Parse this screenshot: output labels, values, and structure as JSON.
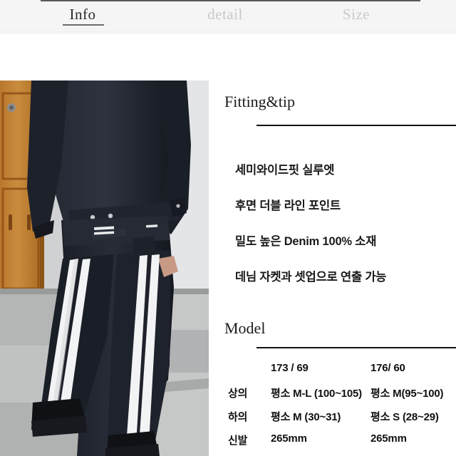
{
  "tabs": [
    {
      "label": "Info",
      "active": true
    },
    {
      "label": "detail",
      "active": false
    },
    {
      "label": "Size",
      "active": false
    }
  ],
  "product_photo": {
    "alt": "Model wearing black denim jacket and black wide-leg denim pants with white double side stripes, standing on concrete steps in front of a wooden door"
  },
  "fitting": {
    "title": "Fitting&tip",
    "features": [
      "세미와이드핏 실루엣",
      "후면 더블 라인 포인트",
      "밀도 높은 Denim 100% 소재",
      "데님 자켓과 셋업으로 연출 가능"
    ]
  },
  "model": {
    "title": "Model",
    "headers": [
      "",
      "173 / 69",
      "176/ 60"
    ],
    "rows": [
      {
        "label": "상의",
        "col1": "평소 M-L (100~105)",
        "col2": "평소 M(95~100)"
      },
      {
        "label": "하의",
        "col1": "평소 M (30~31)",
        "col2": "평소 S (28~29)"
      },
      {
        "label": "신발",
        "col1": "265mm",
        "col2": "265mm"
      }
    ]
  },
  "colors": {
    "tabbar_bg": "#f5f5f5",
    "tab_active": "#2c2c2c",
    "tab_inactive": "#c9c9c9",
    "divider": "#111111",
    "text": "#1a1a1a"
  }
}
